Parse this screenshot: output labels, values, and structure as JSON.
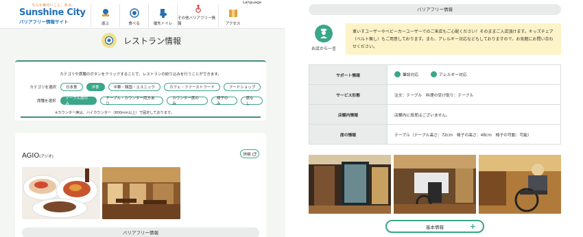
{
  "header": {
    "logo_tagline": "なんか毎日いこと、ある。",
    "logo_title": "Sunshine City",
    "logo_subtitle": "バリアフリー情報サイト",
    "language": "Language",
    "nav": [
      {
        "label": "遊ぶ",
        "icon": "play-icon"
      },
      {
        "label": "食べる",
        "icon": "dining-icon"
      },
      {
        "label": "優先トイレ",
        "icon": "toilet-icon"
      },
      {
        "label": "その他バリアフリー情報",
        "icon": "accessibility-icon"
      },
      {
        "label": "アクセス",
        "icon": "map-icon"
      }
    ]
  },
  "page_title": "レストラン情報",
  "filter": {
    "note": "カテゴリや席種のボタンをクリックすることで、レストランの絞り込みを行うことができます。",
    "category_label": "カテゴリを選択",
    "categories": [
      {
        "label": "日本食",
        "active": false
      },
      {
        "label": "洋食",
        "active": true
      },
      {
        "label": "中華・韓国・エスニック",
        "active": false
      },
      {
        "label": "カフェ・ファーストフード",
        "active": false
      },
      {
        "label": "フードショップ",
        "active": false
      }
    ],
    "seat_label": "席種を選択",
    "seats": [
      {
        "label": "テーブル席のみ",
        "active": true
      },
      {
        "label": "テーブル・カウンター両方あり",
        "active": false
      },
      {
        "label": "カウンター席のみ",
        "active": false
      },
      {
        "label": "椅子のみ",
        "active": false
      },
      {
        "label": "席なし",
        "active": false
      }
    ],
    "footnote": "※カウンター席は、ハイカウンター（800mm以上）で固定しております。"
  },
  "restaurant": {
    "name": "AGIO",
    "name_kana": "(アジオ)",
    "detail_label": "詳細",
    "barrier_free_label": "バリアフリー情報"
  },
  "right": {
    "section_title": "バリアフリー情報",
    "comment_label": "お店から一言",
    "comment_text": "車いすユーザーやベビーカーユーザーでのご来店もご心配ください！そのままご入店頂けます。キッズチェア（ベルト無し）もご用意しております。また、アレルギー対応などもしておりますので、お気軽にお問い合わせください。",
    "table": [
      {
        "label": "サポート情報",
        "value": "",
        "supports": [
          "筆談対応",
          "アレルギー対応"
        ]
      },
      {
        "label": "サービス形態",
        "value": "注文：テーブル　料理の受け取り：テーブル"
      },
      {
        "label": "店舗内情報",
        "value": "店舗内に段差はございません。"
      },
      {
        "label": "席の情報",
        "value": "テーブル（テーブル高さ：72cm　椅子の高さ：48cm　椅子の可動：可能）"
      }
    ],
    "basic_info_label": "基本情報",
    "basic_info_icon": "plus-icon"
  },
  "colors": {
    "accent": "#3aa68a",
    "notice_bg": "#fdf3c8",
    "brand_blue": "#1f6fb8"
  }
}
